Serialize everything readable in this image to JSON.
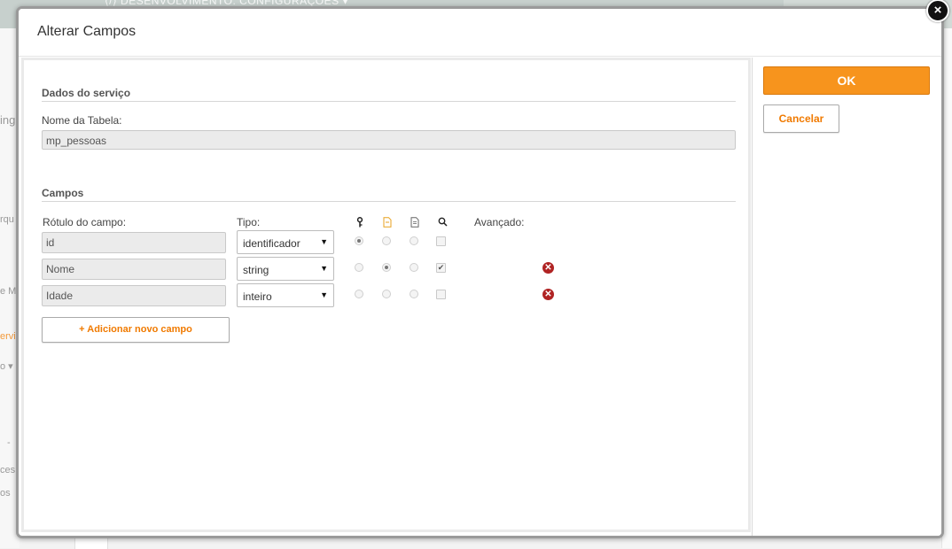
{
  "background": {
    "topbar_text": "⟨/⟩  DESENVOLVIMENTO: CONFIGURAÇÕES  ▾",
    "fragments": [
      {
        "text": "ing",
        "orange": false
      },
      {
        "text": "rqu",
        "orange": false
      },
      {
        "text": "e Ma",
        "orange": false
      },
      {
        "text": "ervi",
        "orange": true
      },
      {
        "text": "o ▾",
        "orange": false
      },
      {
        "text": "-",
        "orange": false
      },
      {
        "text": "ces",
        "orange": false
      },
      {
        "text": "os",
        "orange": false
      }
    ]
  },
  "modal": {
    "title": "Alterar Campos",
    "close_icon": "×",
    "service_section": {
      "title": "Dados do serviço",
      "table_name_label": "Nome da Tabela:",
      "table_name_value": "mp_pessoas"
    },
    "fields_section": {
      "title": "Campos",
      "headers": {
        "label": "Rótulo do campo:",
        "type": "Tipo:",
        "key_icon": "key-icon",
        "doc_icon": "document-icon",
        "doc2_icon": "file-icon",
        "search_icon": "search-icon",
        "advanced": "Avançado:"
      },
      "rows": [
        {
          "label": "id",
          "type": "identificador",
          "radio1": true,
          "radio2": false,
          "radio3": false,
          "checkbox": false,
          "deletable": false
        },
        {
          "label": "Nome",
          "type": "string",
          "radio1": false,
          "radio2": true,
          "radio3": false,
          "checkbox": true,
          "deletable": true
        },
        {
          "label": "Idade",
          "type": "inteiro",
          "radio1": false,
          "radio2": false,
          "radio3": false,
          "checkbox": false,
          "deletable": true
        }
      ],
      "add_button": "+ Adicionar novo campo"
    }
  },
  "sidebar": {
    "ok_label": "OK",
    "cancel_label": "Cancelar"
  },
  "colors": {
    "accent": "#f7941d",
    "accent_text": "#f07a00",
    "delete": "#b02323"
  }
}
